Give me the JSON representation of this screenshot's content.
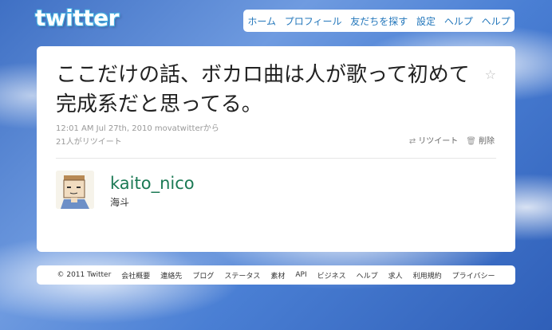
{
  "logo": "twitter",
  "nav": [
    "ホーム",
    "プロフィール",
    "友だちを探す",
    "設定",
    "ヘルプ",
    "ヘルプ"
  ],
  "tweet": {
    "text": "ここだけの話、ボカロ曲は人が歌って初めて完成系だと思ってる。",
    "meta": "12:01 AM Jul 27th, 2010 movatwitterから",
    "retweet_count": "21人がリツイート",
    "retweet_label": "リツイート",
    "delete_label": "削除"
  },
  "user": {
    "username": "kaito_nico",
    "name": "海斗"
  },
  "footer": [
    "© 2011 Twitter",
    "会社概要",
    "連絡先",
    "ブログ",
    "ステータス",
    "素材",
    "API",
    "ビジネス",
    "ヘルプ",
    "求人",
    "利用規約",
    "プライバシー"
  ],
  "colors": {
    "link": "#2276bb",
    "username": "#1c7a55",
    "meta": "#999999"
  }
}
